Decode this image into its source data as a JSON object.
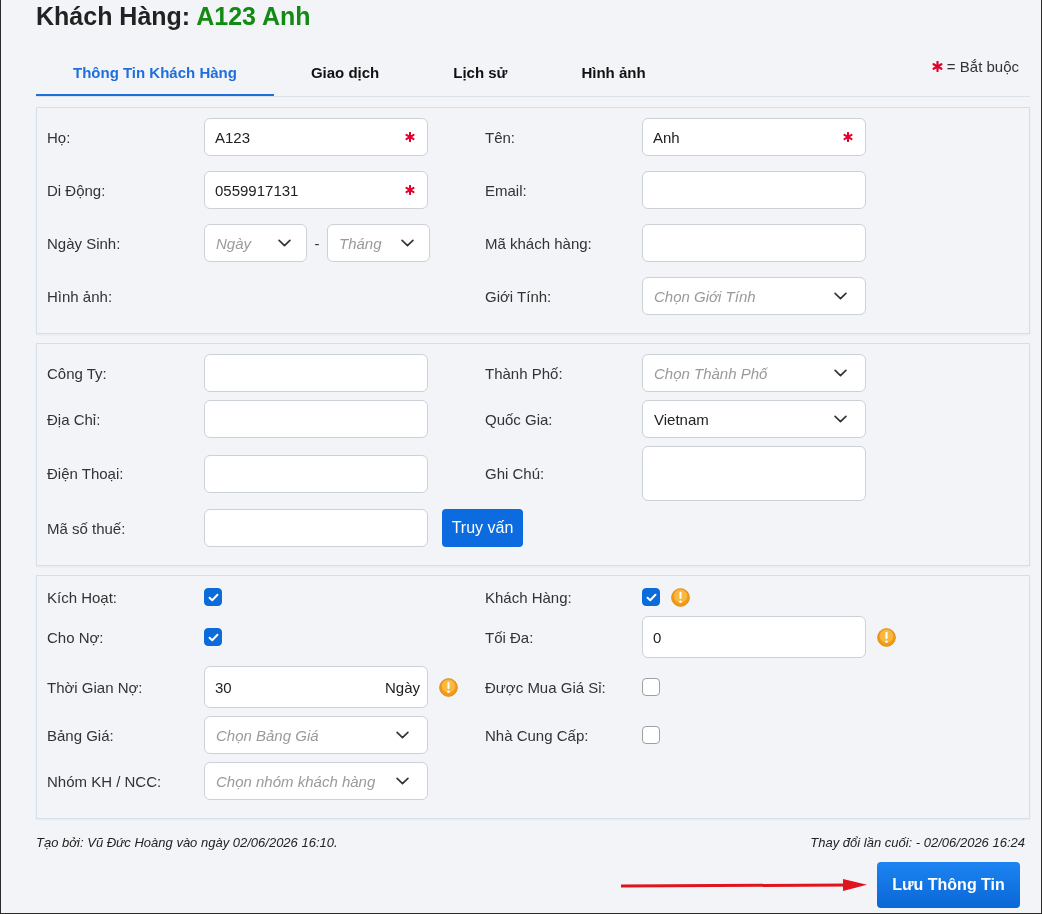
{
  "header": {
    "title": "Khách Hàng:",
    "customer_name": "A123 Anh"
  },
  "tabs": [
    {
      "label": "Thông Tin Khách Hàng",
      "selected": true
    },
    {
      "label": "Giao dịch",
      "selected": false
    },
    {
      "label": "Lịch sử",
      "selected": false
    },
    {
      "label": "Hình ảnh",
      "selected": false
    }
  ],
  "required_legend": {
    "text": "= Bắt buộc"
  },
  "sections": [
    {
      "rows": [
        {
          "left": {
            "label": "Họ:",
            "kind": "text",
            "value": "A123",
            "required": true
          },
          "right": {
            "label": "Tên:",
            "kind": "text",
            "value": "Anh",
            "required": true
          }
        },
        {
          "left": {
            "label": "Di Động:",
            "kind": "text",
            "value": "0559917131",
            "required": true
          },
          "right": {
            "label": "Email:",
            "kind": "text"
          }
        },
        {
          "left": {
            "label": "Ngày Sinh:",
            "kind": "date",
            "parts": [
              {
                "placeholder": "Ngày"
              },
              {
                "placeholder": "Tháng"
              }
            ],
            "separator": "-"
          },
          "right": {
            "label": "Mã khách hàng:",
            "kind": "text"
          }
        },
        {
          "left": {
            "label": "Hình ảnh:",
            "kind": "label"
          },
          "right": {
            "label": "Giới Tính:",
            "kind": "select",
            "placeholder": "Chọn Giới Tính"
          }
        }
      ]
    },
    {
      "rows": [
        {
          "left": {
            "label": "Công Ty:",
            "kind": "text"
          },
          "right": {
            "label": "Thành Phố:",
            "kind": "select",
            "placeholder": "Chọn Thành Phố"
          }
        },
        {
          "left": {
            "label": "Địa Chỉ:",
            "kind": "text"
          },
          "right": {
            "label": "Quốc Gia:",
            "kind": "select",
            "value": "Vietnam"
          }
        },
        {
          "left": {
            "label": "Điện Thoại:",
            "kind": "text"
          },
          "right": {
            "label": "Ghi Chú:",
            "kind": "textarea"
          }
        },
        {
          "left": {
            "label": "Mã số thuế:",
            "kind": "text",
            "button": {
              "label": "Truy vấn"
            }
          }
        }
      ]
    },
    {
      "rows": [
        {
          "left": {
            "label": "Kích Hoạt:",
            "kind": "checkbox",
            "checked": true
          },
          "right": {
            "label": "Khách Hàng:",
            "kind": "checkbox",
            "checked": true,
            "warning": true
          }
        },
        {
          "left": {
            "label": "Cho Nợ:",
            "kind": "checkbox",
            "checked": true
          },
          "right": {
            "label": "Tối Đa:",
            "kind": "text",
            "value": "0",
            "warning": true
          }
        },
        {
          "left": {
            "label": "Thời Gian Nợ:",
            "kind": "text",
            "value": "30",
            "suffix": "Ngày",
            "warning": true
          },
          "right": {
            "label": "Được Mua Giá Sỉ:",
            "kind": "checkbox",
            "checked": false
          }
        },
        {
          "left": {
            "label": "Bảng Giá:",
            "kind": "select",
            "placeholder": "Chọn Bảng Giá"
          },
          "right": {
            "label": "Nhà Cung Cấp:",
            "kind": "checkbox",
            "checked": false
          }
        },
        {
          "left": {
            "label": "Nhóm KH / NCC:",
            "kind": "select",
            "placeholder": "Chọn nhóm khách hàng"
          }
        }
      ]
    }
  ],
  "footer": {
    "created": "Tạo bởi: Vũ Đức Hoàng vào ngày 02/06/2026 16:10.",
    "modified": "Thay đổi lần cuối: - 02/06/2026 16:24"
  },
  "save_button": {
    "label": "Lưu Thông Tin"
  }
}
